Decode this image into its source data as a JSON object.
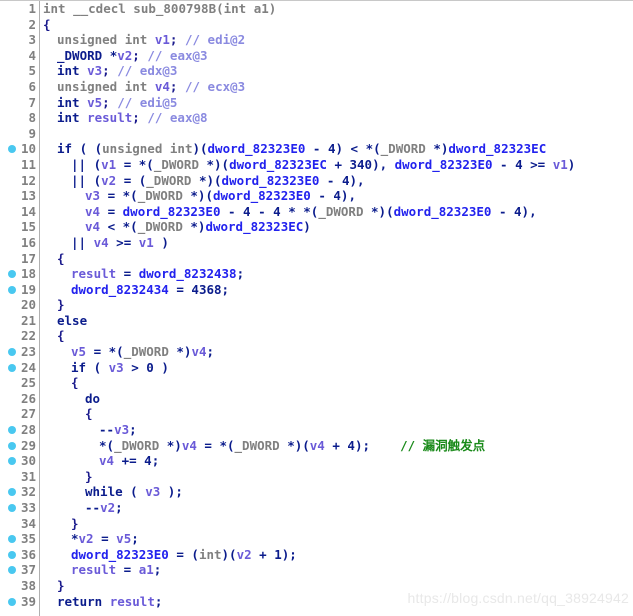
{
  "editor": {
    "name": "decompiler-pseudocode-view",
    "gutter_dot_color": "#49c8f0",
    "background": "#ffffff",
    "watermark": "https://blog.csdn.net/qq_38924942"
  },
  "lines": [
    {
      "n": "1",
      "bp": false,
      "indent": 0,
      "tokens": [
        {
          "t": "int __cdecl sub_800798B(int a1)",
          "c": "t-gray"
        }
      ]
    },
    {
      "n": "2",
      "bp": false,
      "indent": 0,
      "tokens": [
        {
          "t": "{",
          "c": "t-punct"
        }
      ]
    },
    {
      "n": "3",
      "bp": false,
      "indent": 1,
      "tokens": [
        {
          "t": "unsigned int ",
          "c": "t-gray"
        },
        {
          "t": "v1",
          "c": "t-var"
        },
        {
          "t": "; ",
          "c": "t-punct"
        },
        {
          "t": "// edi@2",
          "c": "t-cmt"
        }
      ]
    },
    {
      "n": "4",
      "bp": false,
      "indent": 1,
      "tokens": [
        {
          "t": "_DWORD ",
          "c": "t-navy"
        },
        {
          "t": "*",
          "c": "t-navy"
        },
        {
          "t": "v2",
          "c": "t-var"
        },
        {
          "t": "; ",
          "c": "t-punct"
        },
        {
          "t": "// eax@3",
          "c": "t-cmt"
        }
      ]
    },
    {
      "n": "5",
      "bp": false,
      "indent": 1,
      "tokens": [
        {
          "t": "int ",
          "c": "t-navy"
        },
        {
          "t": "v3",
          "c": "t-var"
        },
        {
          "t": "; ",
          "c": "t-punct"
        },
        {
          "t": "// edx@3",
          "c": "t-cmt"
        }
      ]
    },
    {
      "n": "6",
      "bp": false,
      "indent": 1,
      "tokens": [
        {
          "t": "unsigned int ",
          "c": "t-gray"
        },
        {
          "t": "v4",
          "c": "t-var"
        },
        {
          "t": "; ",
          "c": "t-punct"
        },
        {
          "t": "// ecx@3",
          "c": "t-cmt"
        }
      ]
    },
    {
      "n": "7",
      "bp": false,
      "indent": 1,
      "tokens": [
        {
          "t": "int ",
          "c": "t-navy"
        },
        {
          "t": "v5",
          "c": "t-var"
        },
        {
          "t": "; ",
          "c": "t-punct"
        },
        {
          "t": "// edi@5",
          "c": "t-cmt"
        }
      ]
    },
    {
      "n": "8",
      "bp": false,
      "indent": 1,
      "tokens": [
        {
          "t": "int ",
          "c": "t-navy"
        },
        {
          "t": "result",
          "c": "t-var"
        },
        {
          "t": "; ",
          "c": "t-punct"
        },
        {
          "t": "// eax@8",
          "c": "t-cmt"
        }
      ]
    },
    {
      "n": "9",
      "bp": false,
      "indent": 0,
      "tokens": []
    },
    {
      "n": "10",
      "bp": true,
      "indent": 1,
      "tokens": [
        {
          "t": "if ( (",
          "c": "t-navy"
        },
        {
          "t": "unsigned int",
          "c": "t-gray"
        },
        {
          "t": ")(",
          "c": "t-navy"
        },
        {
          "t": "dword_82323E0",
          "c": "t-blue"
        },
        {
          "t": " - 4) < *(",
          "c": "t-navy"
        },
        {
          "t": "_DWORD ",
          "c": "t-gray"
        },
        {
          "t": "*)",
          "c": "t-navy"
        },
        {
          "t": "dword_82323EC",
          "c": "t-blue"
        }
      ]
    },
    {
      "n": "11",
      "bp": false,
      "indent": 2,
      "tokens": [
        {
          "t": "|| (",
          "c": "t-navy"
        },
        {
          "t": "v1",
          "c": "t-var"
        },
        {
          "t": " = *(",
          "c": "t-navy"
        },
        {
          "t": "_DWORD ",
          "c": "t-gray"
        },
        {
          "t": "*)(",
          "c": "t-navy"
        },
        {
          "t": "dword_82323EC",
          "c": "t-blue"
        },
        {
          "t": " + 340), ",
          "c": "t-navy"
        },
        {
          "t": "dword_82323E0",
          "c": "t-blue"
        },
        {
          "t": " - 4 >= ",
          "c": "t-navy"
        },
        {
          "t": "v1",
          "c": "t-var"
        },
        {
          "t": ")",
          "c": "t-navy"
        }
      ]
    },
    {
      "n": "12",
      "bp": false,
      "indent": 2,
      "tokens": [
        {
          "t": "|| (",
          "c": "t-navy"
        },
        {
          "t": "v2",
          "c": "t-var"
        },
        {
          "t": " = (",
          "c": "t-navy"
        },
        {
          "t": "_DWORD ",
          "c": "t-gray"
        },
        {
          "t": "*)(",
          "c": "t-navy"
        },
        {
          "t": "dword_82323E0",
          "c": "t-blue"
        },
        {
          "t": " - 4),",
          "c": "t-navy"
        }
      ]
    },
    {
      "n": "13",
      "bp": false,
      "indent": 3,
      "tokens": [
        {
          "t": "v3",
          "c": "t-var"
        },
        {
          "t": " = *(",
          "c": "t-navy"
        },
        {
          "t": "_DWORD ",
          "c": "t-gray"
        },
        {
          "t": "*)(",
          "c": "t-navy"
        },
        {
          "t": "dword_82323E0",
          "c": "t-blue"
        },
        {
          "t": " - 4),",
          "c": "t-navy"
        }
      ]
    },
    {
      "n": "14",
      "bp": false,
      "indent": 3,
      "tokens": [
        {
          "t": "v4",
          "c": "t-var"
        },
        {
          "t": " = ",
          "c": "t-navy"
        },
        {
          "t": "dword_82323E0",
          "c": "t-blue"
        },
        {
          "t": " - 4 - 4 * *(",
          "c": "t-navy"
        },
        {
          "t": "_DWORD ",
          "c": "t-gray"
        },
        {
          "t": "*)(",
          "c": "t-navy"
        },
        {
          "t": "dword_82323E0",
          "c": "t-blue"
        },
        {
          "t": " - 4),",
          "c": "t-navy"
        }
      ]
    },
    {
      "n": "15",
      "bp": false,
      "indent": 3,
      "tokens": [
        {
          "t": "v4",
          "c": "t-var"
        },
        {
          "t": " < *(",
          "c": "t-navy"
        },
        {
          "t": "_DWORD ",
          "c": "t-gray"
        },
        {
          "t": "*)",
          "c": "t-navy"
        },
        {
          "t": "dword_82323EC",
          "c": "t-blue"
        },
        {
          "t": ")",
          "c": "t-navy"
        }
      ]
    },
    {
      "n": "16",
      "bp": false,
      "indent": 2,
      "tokens": [
        {
          "t": "|| ",
          "c": "t-navy"
        },
        {
          "t": "v4",
          "c": "t-var"
        },
        {
          "t": " >= ",
          "c": "t-navy"
        },
        {
          "t": "v1",
          "c": "t-var"
        },
        {
          "t": " )",
          "c": "t-navy"
        }
      ]
    },
    {
      "n": "17",
      "bp": false,
      "indent": 1,
      "tokens": [
        {
          "t": "{",
          "c": "t-punct"
        }
      ]
    },
    {
      "n": "18",
      "bp": true,
      "indent": 2,
      "tokens": [
        {
          "t": "result",
          "c": "t-var"
        },
        {
          "t": " = ",
          "c": "t-navy"
        },
        {
          "t": "dword_8232438",
          "c": "t-blue"
        },
        {
          "t": ";",
          "c": "t-navy"
        }
      ]
    },
    {
      "n": "19",
      "bp": true,
      "indent": 2,
      "tokens": [
        {
          "t": "dword_8232434",
          "c": "t-blue"
        },
        {
          "t": " = 4368;",
          "c": "t-navy"
        }
      ]
    },
    {
      "n": "20",
      "bp": false,
      "indent": 1,
      "tokens": [
        {
          "t": "}",
          "c": "t-punct"
        }
      ]
    },
    {
      "n": "21",
      "bp": false,
      "indent": 1,
      "tokens": [
        {
          "t": "else",
          "c": "t-navy"
        }
      ]
    },
    {
      "n": "22",
      "bp": false,
      "indent": 1,
      "tokens": [
        {
          "t": "{",
          "c": "t-punct"
        }
      ]
    },
    {
      "n": "23",
      "bp": true,
      "indent": 2,
      "tokens": [
        {
          "t": "v5",
          "c": "t-var"
        },
        {
          "t": " = *(",
          "c": "t-navy"
        },
        {
          "t": "_DWORD ",
          "c": "t-gray"
        },
        {
          "t": "*)",
          "c": "t-navy"
        },
        {
          "t": "v4",
          "c": "t-var"
        },
        {
          "t": ";",
          "c": "t-navy"
        }
      ]
    },
    {
      "n": "24",
      "bp": true,
      "indent": 2,
      "tokens": [
        {
          "t": "if ( ",
          "c": "t-navy"
        },
        {
          "t": "v3",
          "c": "t-var"
        },
        {
          "t": " > 0 )",
          "c": "t-navy"
        }
      ]
    },
    {
      "n": "25",
      "bp": false,
      "indent": 2,
      "tokens": [
        {
          "t": "{",
          "c": "t-punct"
        }
      ]
    },
    {
      "n": "26",
      "bp": false,
      "indent": 3,
      "tokens": [
        {
          "t": "do",
          "c": "t-navy"
        }
      ]
    },
    {
      "n": "27",
      "bp": false,
      "indent": 3,
      "tokens": [
        {
          "t": "{",
          "c": "t-punct"
        }
      ]
    },
    {
      "n": "28",
      "bp": true,
      "indent": 4,
      "tokens": [
        {
          "t": "--",
          "c": "t-navy"
        },
        {
          "t": "v3",
          "c": "t-var"
        },
        {
          "t": ";",
          "c": "t-navy"
        }
      ]
    },
    {
      "n": "29",
      "bp": true,
      "indent": 4,
      "tokens": [
        {
          "t": "*(",
          "c": "t-navy"
        },
        {
          "t": "_DWORD ",
          "c": "t-gray"
        },
        {
          "t": "*)",
          "c": "t-navy"
        },
        {
          "t": "v4",
          "c": "t-var"
        },
        {
          "t": " = *(",
          "c": "t-navy"
        },
        {
          "t": "_DWORD ",
          "c": "t-gray"
        },
        {
          "t": "*)(",
          "c": "t-navy"
        },
        {
          "t": "v4",
          "c": "t-var"
        },
        {
          "t": " + 4);",
          "c": "t-navy"
        },
        {
          "t": "    ",
          "c": "t-navy"
        },
        {
          "t": "// 漏洞触发点",
          "c": "t-cmtg"
        }
      ]
    },
    {
      "n": "30",
      "bp": true,
      "indent": 4,
      "tokens": [
        {
          "t": "v4",
          "c": "t-var"
        },
        {
          "t": " += 4;",
          "c": "t-navy"
        }
      ]
    },
    {
      "n": "31",
      "bp": false,
      "indent": 3,
      "tokens": [
        {
          "t": "}",
          "c": "t-punct"
        }
      ]
    },
    {
      "n": "32",
      "bp": true,
      "indent": 3,
      "tokens": [
        {
          "t": "while ( ",
          "c": "t-navy"
        },
        {
          "t": "v3",
          "c": "t-var"
        },
        {
          "t": " );",
          "c": "t-navy"
        }
      ]
    },
    {
      "n": "33",
      "bp": true,
      "indent": 3,
      "tokens": [
        {
          "t": "--",
          "c": "t-navy"
        },
        {
          "t": "v2",
          "c": "t-var"
        },
        {
          "t": ";",
          "c": "t-navy"
        }
      ]
    },
    {
      "n": "34",
      "bp": false,
      "indent": 2,
      "tokens": [
        {
          "t": "}",
          "c": "t-punct"
        }
      ]
    },
    {
      "n": "35",
      "bp": true,
      "indent": 2,
      "tokens": [
        {
          "t": "*",
          "c": "t-navy"
        },
        {
          "t": "v2",
          "c": "t-var"
        },
        {
          "t": " = ",
          "c": "t-navy"
        },
        {
          "t": "v5",
          "c": "t-var"
        },
        {
          "t": ";",
          "c": "t-navy"
        }
      ]
    },
    {
      "n": "36",
      "bp": true,
      "indent": 2,
      "tokens": [
        {
          "t": "dword_82323E0",
          "c": "t-blue"
        },
        {
          "t": " = (",
          "c": "t-navy"
        },
        {
          "t": "int",
          "c": "t-gray"
        },
        {
          "t": ")(",
          "c": "t-navy"
        },
        {
          "t": "v2",
          "c": "t-var"
        },
        {
          "t": " + 1);",
          "c": "t-navy"
        }
      ]
    },
    {
      "n": "37",
      "bp": true,
      "indent": 2,
      "tokens": [
        {
          "t": "result",
          "c": "t-var"
        },
        {
          "t": " = ",
          "c": "t-navy"
        },
        {
          "t": "a1",
          "c": "t-var"
        },
        {
          "t": ";",
          "c": "t-navy"
        }
      ]
    },
    {
      "n": "38",
      "bp": false,
      "indent": 1,
      "tokens": [
        {
          "t": "}",
          "c": "t-punct"
        }
      ]
    },
    {
      "n": "39",
      "bp": true,
      "indent": 1,
      "tokens": [
        {
          "t": "return ",
          "c": "t-navy"
        },
        {
          "t": "result",
          "c": "t-var"
        },
        {
          "t": ";",
          "c": "t-navy"
        }
      ]
    }
  ]
}
